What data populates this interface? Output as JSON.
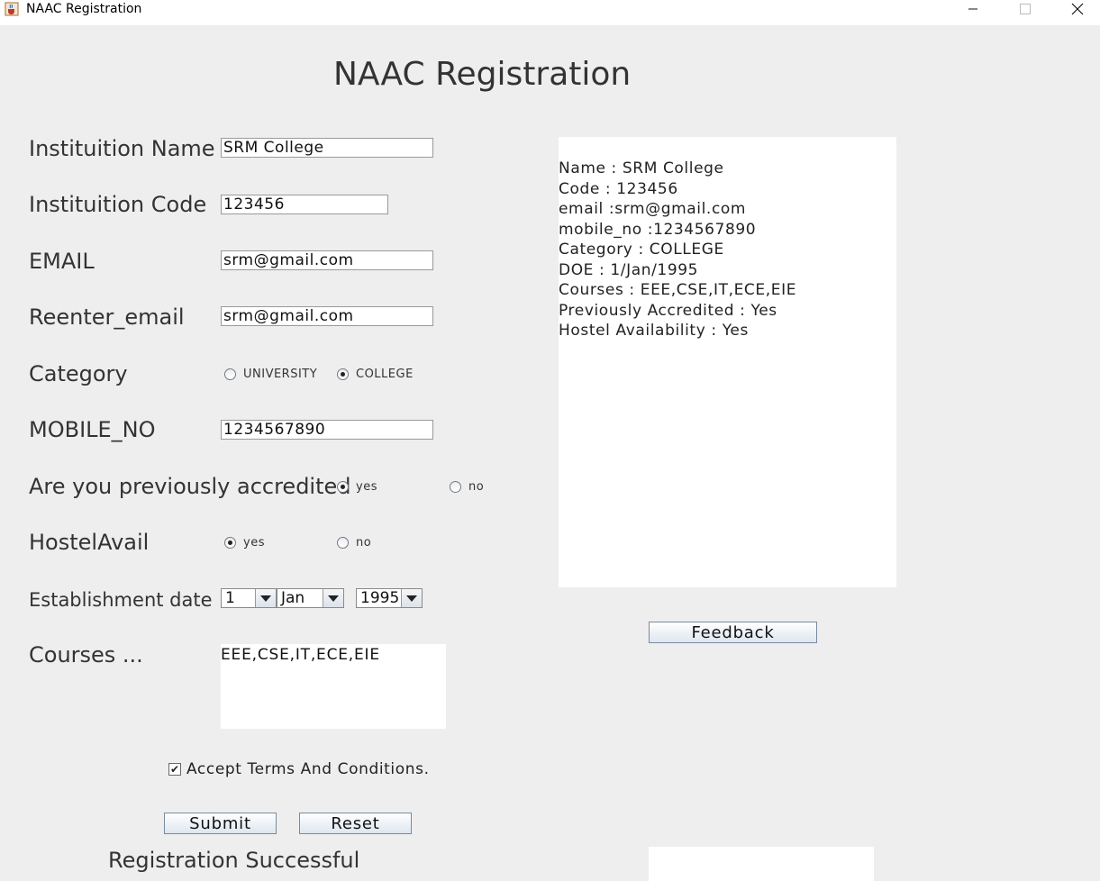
{
  "window": {
    "title": "NAAC Registration"
  },
  "heading": "NAAC Registration",
  "form": {
    "institution_name": {
      "label": "Instituition Name",
      "value": "SRM College"
    },
    "institution_code": {
      "label": "Instituition Code",
      "value": "123456"
    },
    "email": {
      "label": "EMAIL",
      "value": "srm@gmail.com"
    },
    "reenter_email": {
      "label": "Reenter_email",
      "value": "srm@gmail.com"
    },
    "category": {
      "label": "Category",
      "options": [
        "UNIVERSITY",
        "COLLEGE"
      ],
      "selected": "COLLEGE"
    },
    "mobile_no": {
      "label": "MOBILE_NO",
      "value": "1234567890"
    },
    "accredited": {
      "label": "Are you previously accredited",
      "options": [
        "yes",
        "no"
      ],
      "selected": "yes"
    },
    "hostel": {
      "label": "HostelAvail",
      "options": [
        "yes",
        "no"
      ],
      "selected": "yes"
    },
    "establishment": {
      "label": "Establishment date",
      "day": "1",
      "month": "Jan",
      "year": "1995"
    },
    "courses": {
      "label": "Courses ...",
      "value": "EEE,CSE,IT,ECE,EIE"
    },
    "terms": {
      "label": "Accept Terms And Conditions.",
      "checked": true
    },
    "submit_label": "Submit",
    "reset_label": "Reset",
    "status": "Registration Successful"
  },
  "output": {
    "lines": [
      "Name : SRM College",
      "Code : 123456",
      "email :srm@gmail.com",
      "mobile_no :1234567890",
      "Category : COLLEGE",
      "DOE : 1/Jan/1995",
      "Courses : EEE,CSE,IT,ECE,EIE",
      "Previously Accredited : Yes",
      "Hostel Availability : Yes"
    ]
  },
  "feedback_label": "Feedback",
  "icons": {
    "app": "java-cup-icon",
    "minimize": "minimize-icon",
    "maximize": "maximize-icon",
    "close": "close-icon"
  }
}
